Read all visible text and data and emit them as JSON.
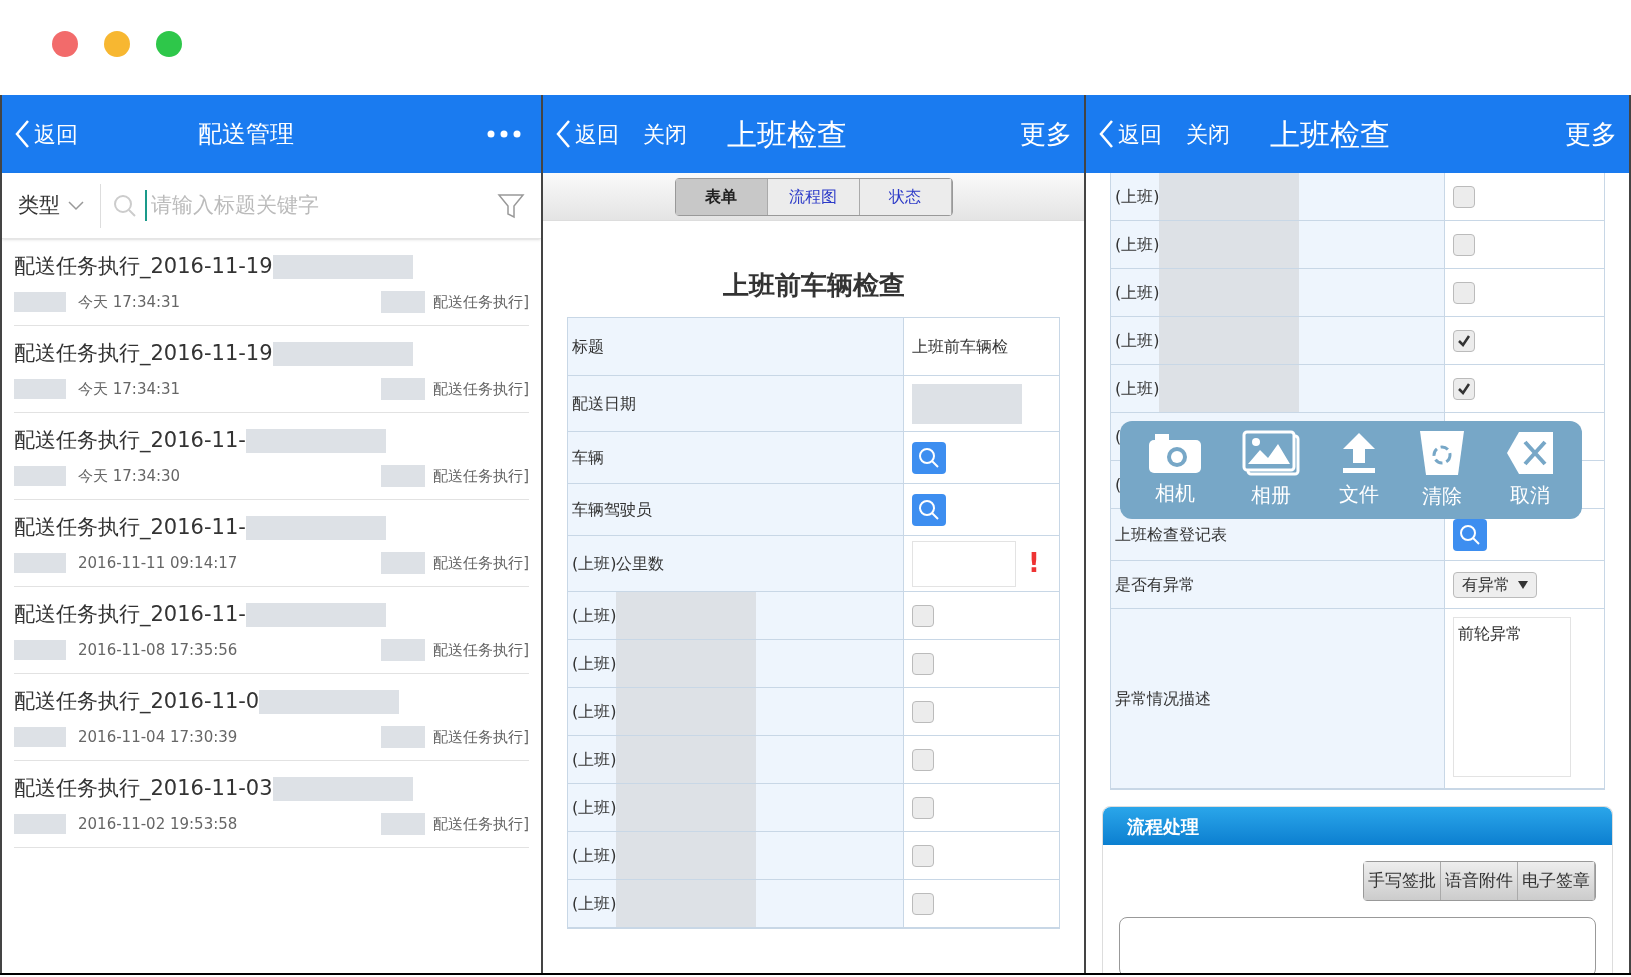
{
  "window": {
    "controls": [
      {
        "color": "#f26b6b"
      },
      {
        "color": "#f7b731"
      },
      {
        "color": "#2ec74a"
      }
    ]
  },
  "list_screen": {
    "header": {
      "back": "返回",
      "title": "配送管理"
    },
    "filter": {
      "type_label": "类型"
    },
    "search": {
      "placeholder": "请输入标题关键字"
    },
    "items": [
      {
        "title": "配送任务执行_2016-11-19",
        "time": "今天 17:34:31",
        "tag": "配送任务执行]"
      },
      {
        "title": "配送任务执行_2016-11-19",
        "time": "今天 17:34:31",
        "tag": "配送任务执行]"
      },
      {
        "title": "配送任务执行_2016-11-",
        "time": "今天 17:34:30",
        "tag": "配送任务执行]"
      },
      {
        "title": "配送任务执行_2016-11-",
        "time": "2016-11-11 09:14:17",
        "tag": "配送任务执行]"
      },
      {
        "title": "配送任务执行_2016-11-",
        "time": "2016-11-08 17:35:56",
        "tag": "配送任务执行]"
      },
      {
        "title": "配送任务执行_2016-11-0",
        "time": "2016-11-04 17:30:39",
        "tag": "配送任务执行]"
      },
      {
        "title": "配送任务执行_2016-11-03",
        "time": "2016-11-02 19:53:58",
        "tag": "配送任务执行]"
      }
    ]
  },
  "form_screen": {
    "header": {
      "back": "返回",
      "close": "关闭",
      "title": "上班检查",
      "more": "更多"
    },
    "tabs": [
      {
        "label": "表单",
        "selected": true
      },
      {
        "label": "流程图",
        "selected": false
      },
      {
        "label": "状态",
        "selected": false
      }
    ],
    "form_title": "上班前车辆检查",
    "fields": [
      {
        "kind": "text",
        "label": "标题",
        "value": "上班前车辆检"
      },
      {
        "kind": "blurred",
        "label": "配送日期"
      },
      {
        "kind": "lookup",
        "label": "车辆"
      },
      {
        "kind": "lookup",
        "label": "车辆驾驶员"
      },
      {
        "kind": "number",
        "label": "(上班)公里数",
        "mark": "!"
      },
      {
        "kind": "checkbox",
        "label": "(上班)",
        "checked": false
      },
      {
        "kind": "checkbox",
        "label": "(上班)",
        "checked": false
      },
      {
        "kind": "checkbox",
        "label": "(上班)",
        "checked": false
      },
      {
        "kind": "checkbox",
        "label": "(上班)",
        "checked": false
      },
      {
        "kind": "checkbox",
        "label": "(上班)",
        "checked": false
      },
      {
        "kind": "checkbox",
        "label": "(上班)",
        "checked": false
      },
      {
        "kind": "checkbox",
        "label": "(上班)",
        "checked": false
      }
    ]
  },
  "detail_screen": {
    "header": {
      "back": "返回",
      "close": "关闭",
      "title": "上班检查",
      "more": "更多"
    },
    "fields": [
      {
        "kind": "checkbox",
        "label": "(上班)",
        "checked": false
      },
      {
        "kind": "checkbox",
        "label": "(上班)",
        "checked": false
      },
      {
        "kind": "checkbox",
        "label": "(上班)",
        "checked": false
      },
      {
        "kind": "checkbox",
        "label": "(上班)",
        "checked": true
      },
      {
        "kind": "checkbox",
        "label": "(上班)",
        "checked": true
      },
      {
        "kind": "covered",
        "label": "("
      },
      {
        "kind": "covered",
        "label": "("
      },
      {
        "kind": "lookup",
        "label": "上班检查登记表"
      },
      {
        "kind": "select",
        "label": "是否有异常",
        "value": "有异常"
      },
      {
        "kind": "textarea",
        "label": "异常情况描述",
        "value": "前轮异常"
      }
    ],
    "popup": [
      {
        "kind": "camera",
        "label": "相机"
      },
      {
        "kind": "album",
        "label": "相册"
      },
      {
        "kind": "upload",
        "label": "文件"
      },
      {
        "kind": "trash",
        "label": "清除"
      },
      {
        "kind": "cancel",
        "label": "取消"
      }
    ],
    "section": {
      "title": "流程处理",
      "buttons": [
        "手写签批",
        "语音附件",
        "电子签章"
      ]
    }
  }
}
